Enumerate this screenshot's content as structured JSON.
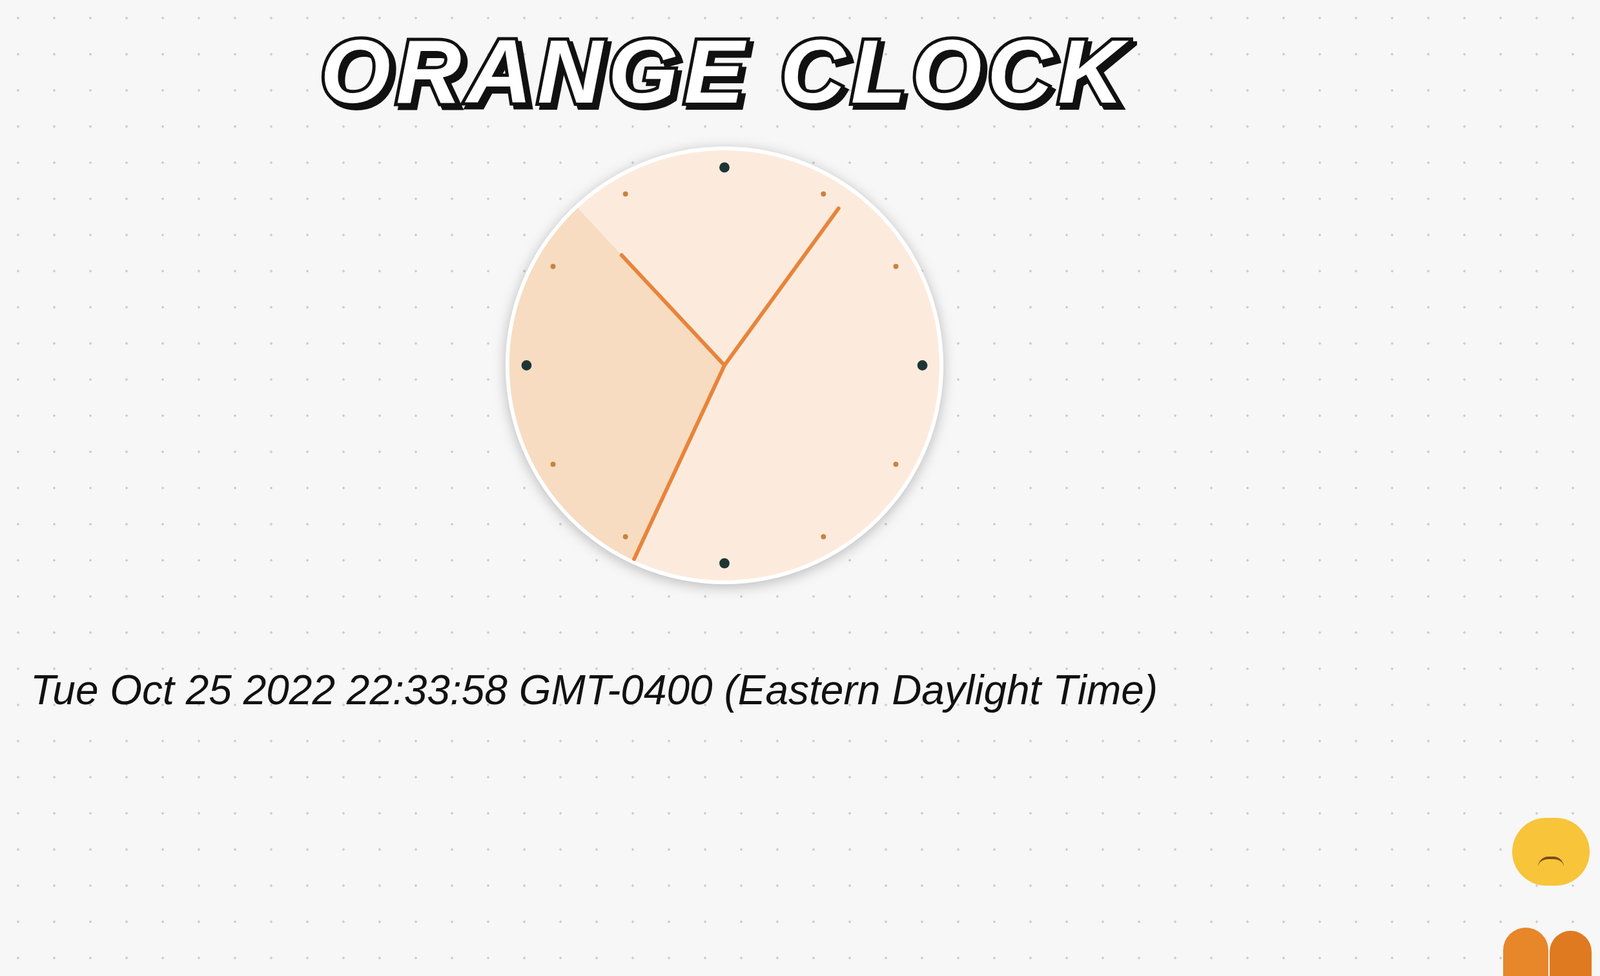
{
  "title": "ORANGE CLOCK",
  "clock": {
    "hour_angle": 317,
    "minute_angle": 36,
    "second_angle": 205
  },
  "datetime": "Tue Oct 25 2022 22:33:58 GMT-0400 (Eastern Daylight Time)"
}
